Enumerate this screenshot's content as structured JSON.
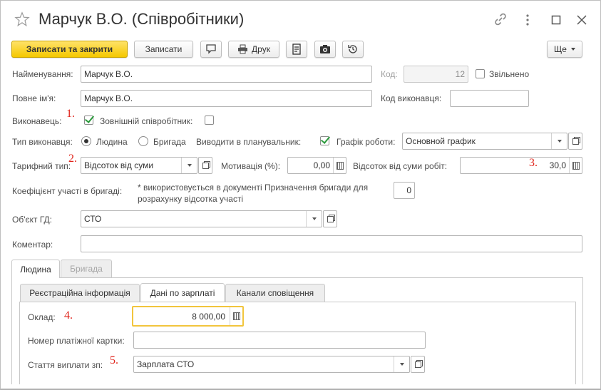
{
  "header": {
    "title": "Марчук В.О. (Співробітники)",
    "icons": [
      "star-icon",
      "link-icon",
      "more-icon",
      "maximize-icon",
      "close-icon"
    ]
  },
  "toolbar": {
    "save_close": "Записати та закрити",
    "save": "Записати",
    "print": "Друк",
    "more": "Ще"
  },
  "form": {
    "name_label": "Найменування:",
    "name_value": "Марчук В.О.",
    "code_label": "Код:",
    "code_value": "12",
    "dismissed_label": "Звільнено",
    "fullname_label": "Повне ім'я:",
    "fullname_value": "Марчук В.О.",
    "executor_code_label": "Код виконавця:",
    "executor_code_value": "",
    "executor_label": "Виконавець:",
    "external_label": "Зовнішній співробітник:",
    "executor_type_label": "Тип виконавця:",
    "radio_person": "Людина",
    "radio_brigade": "Бригада",
    "planner_label": "Виводити в планувальник:",
    "schedule_label": "Графік роботи:",
    "schedule_value": "Основной график",
    "tariff_label": "Тарифний тип:",
    "tariff_value": "Відсоток від суми",
    "motivation_label": "Мотивація (%):",
    "motivation_value": "0,00",
    "percent_works_label": "Відсоток від суми робіт:",
    "percent_works_value": "30,0",
    "coef_label": "Коефіцієнт участі в бригаді:",
    "coef_note_line1": "* використовується в документі Призначення бригади для",
    "coef_note_line2": "розрахунку відсотка участі",
    "coef_value": "0",
    "object_label": "Об'єкт ГД:",
    "object_value": "СТО",
    "comment_label": "Коментар:",
    "comment_value": ""
  },
  "tabs": {
    "outer": [
      {
        "label": "Людина"
      },
      {
        "label": "Бригада"
      }
    ],
    "inner": [
      {
        "label": "Реєстраційна інформація"
      },
      {
        "label": "Дані по зарплаті"
      },
      {
        "label": "Канали сповіщення"
      }
    ]
  },
  "salary": {
    "salary_label": "Оклад:",
    "salary_value": "8 000,00",
    "card_label": "Номер платіжної картки:",
    "card_value": "",
    "article_label": "Стаття виплати зп:",
    "article_value": "Зарплата СТО"
  },
  "annotations": [
    "1.",
    "2.",
    "3.",
    "4.",
    "5."
  ],
  "colors": {
    "primary_button": "#f5c800",
    "annotation": "#e0231a",
    "checkbox_check": "#2b9a3c",
    "focus_border": "#f2c53d"
  }
}
